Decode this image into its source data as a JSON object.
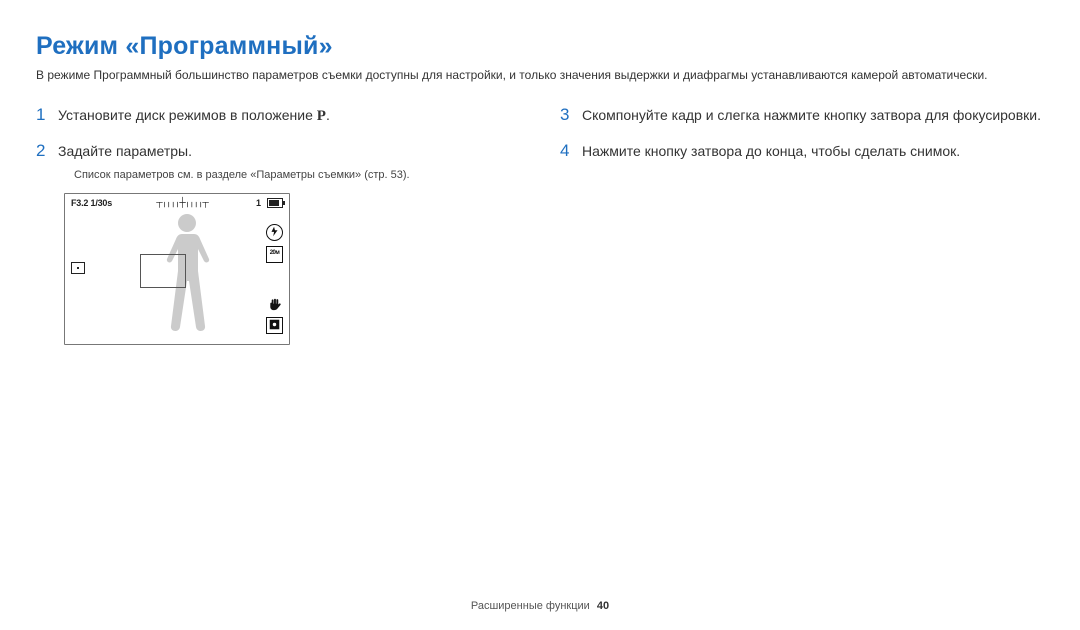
{
  "title": "Режим «Программный»",
  "intro": "В режиме Программный большинство параметров съемки доступны для настройки, и только значения выдержки и диафрагмы устанавливаются камерой автоматически.",
  "left": {
    "step1_pre": "Установите диск режимов в положение ",
    "step1_mode": "P",
    "step1_post": ".",
    "step2": "Задайте параметры.",
    "subnote": "Список параметров см. в разделе «Параметры съемки» (стр. 53)."
  },
  "right": {
    "step3": "Скомпонуйте кадр и слегка нажмите кнопку затвора для фокусировки.",
    "step4": "Нажмите кнопку затвора до конца, чтобы сделать снимок."
  },
  "lcd": {
    "aperture_shutter": "F3.2 1/30s",
    "ev_scale": "┬╷╷╷╷┼╷╷╷╷┬",
    "shots_remaining": "1",
    "size_label": "20м"
  },
  "nums": {
    "n1": "1",
    "n2": "2",
    "n3": "3",
    "n4": "4"
  },
  "footer": {
    "section": "Расширенные функции",
    "page": "40"
  }
}
